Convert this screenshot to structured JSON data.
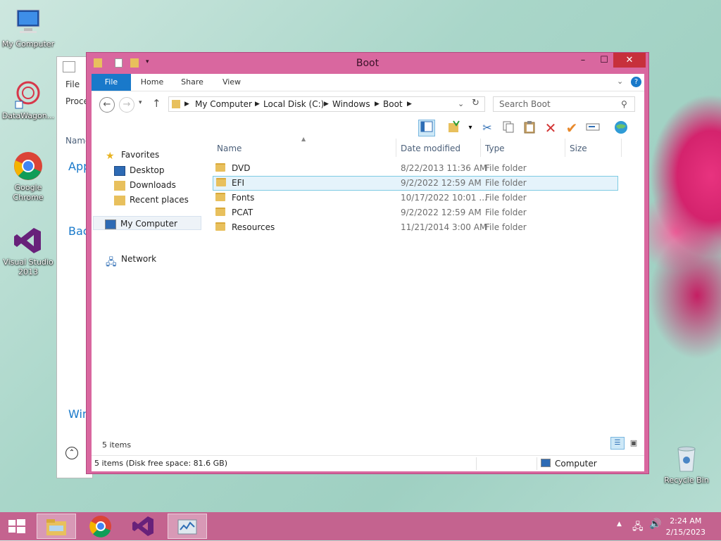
{
  "desktop": {
    "icons": [
      {
        "label": "My Computer"
      },
      {
        "label": "DataWagon..."
      },
      {
        "label": "Google Chrome"
      },
      {
        "label": "Visual Studio 2013"
      },
      {
        "label": "Recycle Bin"
      }
    ]
  },
  "background_window": {
    "menu": "File",
    "tab": "Proce",
    "col": "Name",
    "group_app": "App",
    "group_bac": "Bac",
    "group_win": "Win"
  },
  "window": {
    "title": "Boot",
    "controls": {
      "minimize": "–",
      "maximize": "☐",
      "close": "✕"
    },
    "ribbon": {
      "file": "File",
      "home": "Home",
      "share": "Share",
      "view": "View"
    },
    "breadcrumbs": [
      "My Computer",
      "Local Disk (C:)",
      "Windows",
      "Boot"
    ],
    "search_placeholder": "Search Boot",
    "nav": {
      "favorites": "Favorites",
      "desktop": "Desktop",
      "downloads": "Downloads",
      "recent": "Recent places",
      "computer": "My Computer",
      "network": "Network"
    },
    "columns": {
      "name": "Name",
      "date": "Date modified",
      "type": "Type",
      "size": "Size"
    },
    "files": [
      {
        "name": "DVD",
        "date": "8/22/2013 11:36 AM",
        "type": "File folder"
      },
      {
        "name": "EFI",
        "date": "9/2/2022 12:59 AM",
        "type": "File folder"
      },
      {
        "name": "Fonts",
        "date": "10/17/2022 10:01 ...",
        "type": "File folder"
      },
      {
        "name": "PCAT",
        "date": "9/2/2022 12:59 AM",
        "type": "File folder"
      },
      {
        "name": "Resources",
        "date": "11/21/2014 3:00 AM",
        "type": "File folder"
      }
    ],
    "selected_index": 1,
    "item_count": "5 items",
    "status_left": "5 items (Disk free space: 81.6 GB)",
    "status_right": "Computer"
  },
  "taskbar": {
    "time": "2:24 AM",
    "date": "2/15/2023"
  },
  "colors": {
    "accent": "#1979ca",
    "window_frame": "#d9679f",
    "taskbar": "#c4638f",
    "close": "#c7303b"
  }
}
